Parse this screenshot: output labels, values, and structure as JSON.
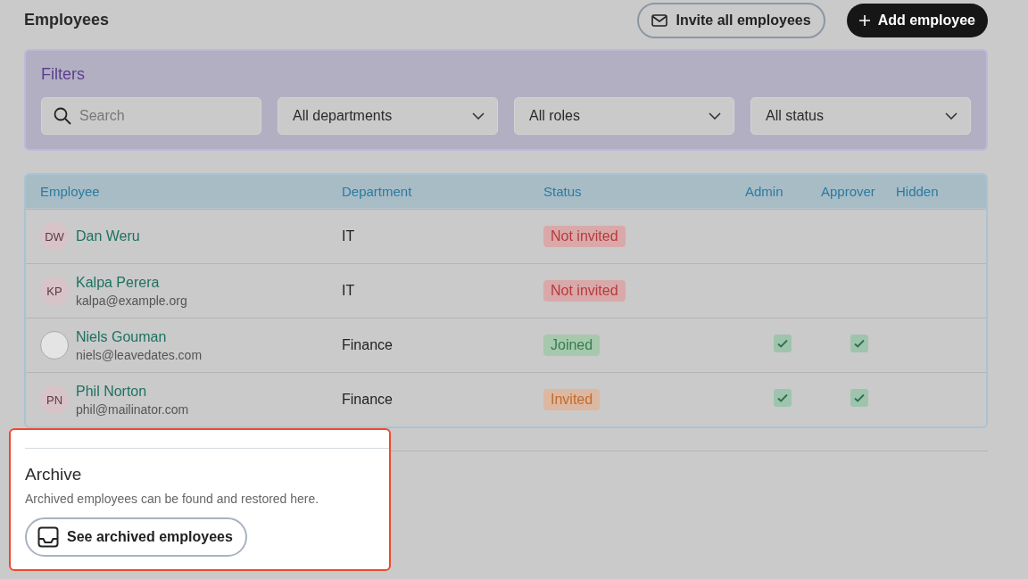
{
  "page": {
    "title": "Employees"
  },
  "header_buttons": [
    {
      "label": "Invite all employees",
      "kind": "outline"
    },
    {
      "label": "Add employee",
      "kind": "primary"
    }
  ],
  "filters": {
    "title": "Filters",
    "search": {
      "placeholder": "Search"
    },
    "dropdowns": [
      "All departments",
      "All roles",
      "All status"
    ]
  },
  "table": {
    "columns": [
      "Employee",
      "Department",
      "Status",
      "Admin",
      "Approver",
      "Hidden"
    ],
    "rows": [
      {
        "name": "Dan Weru",
        "avatar": {
          "kind": "initials",
          "text": "DW"
        },
        "department": "IT",
        "status": {
          "label": "Not invited",
          "kind": "danger"
        },
        "admin": false,
        "approver": false,
        "hidden": false
      },
      {
        "name": "Kalpa Perera",
        "email": "kalpa@example.org",
        "avatar": {
          "kind": "initials",
          "text": "KP"
        },
        "department": "IT",
        "status": {
          "label": "Not invited",
          "kind": "danger"
        },
        "admin": false,
        "approver": false,
        "hidden": false
      },
      {
        "name": "Niels Gouman",
        "email": "niels@leavedates.com",
        "avatar": {
          "kind": "photo"
        },
        "department": "Finance",
        "status": {
          "label": "Joined",
          "kind": "success"
        },
        "admin": true,
        "approver": true,
        "hidden": false
      },
      {
        "name": "Phil Norton",
        "email": "phil@mailinator.com",
        "avatar": {
          "kind": "initials",
          "text": "PN"
        },
        "department": "Finance",
        "status": {
          "label": "Invited",
          "kind": "warning"
        },
        "admin": true,
        "approver": true,
        "hidden": false
      }
    ]
  },
  "archive": {
    "title": "Archive",
    "description": "Archived employees can be found and restored here.",
    "button": "See archived employees"
  }
}
